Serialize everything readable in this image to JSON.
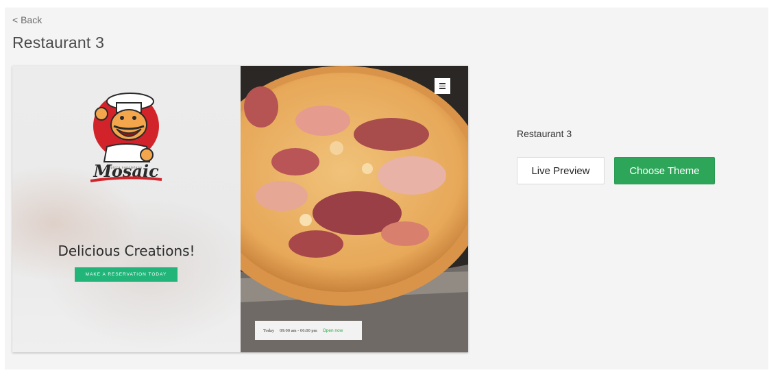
{
  "nav": {
    "back_label": "< Back"
  },
  "page": {
    "title": "Restaurant 3"
  },
  "preview": {
    "brand_name": "Mosaic",
    "brand_tagline": "pizza napoletana",
    "hero_heading": "Delicious Creations!",
    "reserve_button": "MAKE A RESERVATION TODAY",
    "hours": {
      "day": "Today",
      "time": "09:00 am - 06:00 pm",
      "status": "Open now"
    }
  },
  "details": {
    "name": "Restaurant 3",
    "live_preview_label": "Live Preview",
    "choose_theme_label": "Choose Theme"
  },
  "colors": {
    "accent_green": "#2ea65a",
    "reserve_green": "#21b57a",
    "logo_red": "#d3232a"
  },
  "icons": {
    "menu": "hamburger-menu-icon",
    "chef": "chef-mascot-icon"
  }
}
